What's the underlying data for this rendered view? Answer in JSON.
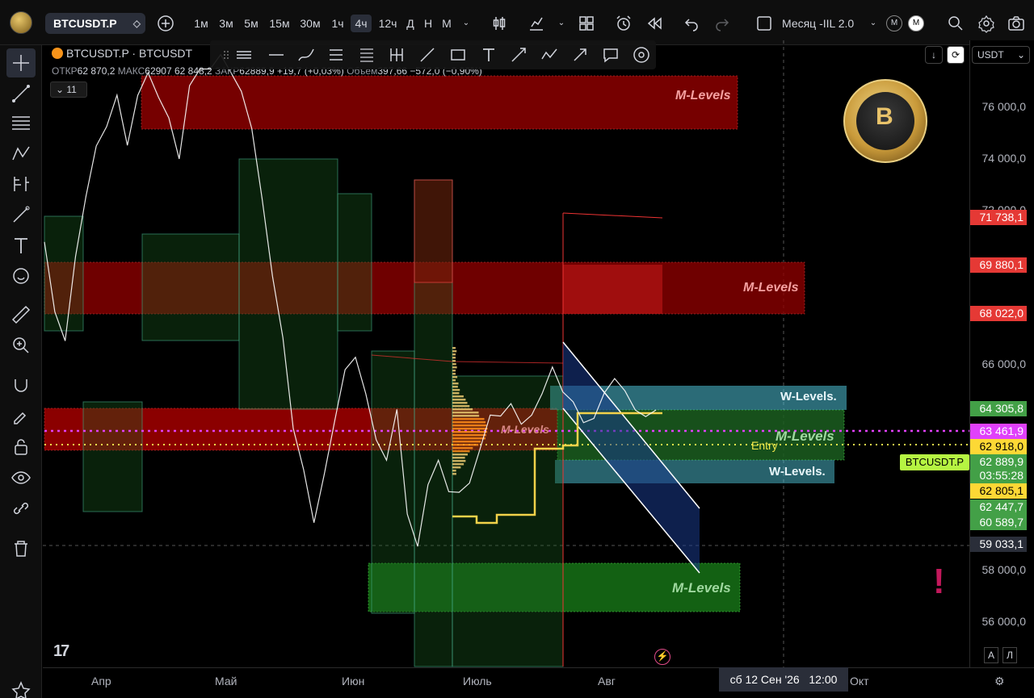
{
  "toolbar": {
    "symbol": "BTCUSDT.P",
    "timeframes": [
      "1м",
      "3м",
      "5м",
      "15м",
      "30м",
      "1ч",
      "4ч",
      "12ч",
      "Д",
      "Н",
      "М"
    ],
    "active_timeframe": "4ч",
    "indicator_name": "Месяц -IIL 2.0",
    "mode_m": "M",
    "mode_m2": "M"
  },
  "legend": {
    "title": "BTCUSDT.P · BTCUSDT",
    "open_label": "ОТКР",
    "open": "62 870,2",
    "high_label": "МАКС",
    "high": "62907",
    "low": "62 848,2",
    "close_label": "ЗАКР",
    "close": "62889,9",
    "change": "+19,7 (+0,03%)",
    "volume_label": "Объем",
    "volume": "397,66",
    "volume_change": "−572,0 (−0,90%)",
    "indicator_count": "11"
  },
  "price_axis": {
    "currency": "USDT",
    "ticks": [
      {
        "label": "76 000,0",
        "value": 76000
      },
      {
        "label": "74 000,0",
        "value": 74000
      },
      {
        "label": "72 000,0",
        "value": 72000
      },
      {
        "label": "66 000,0",
        "value": 66000
      },
      {
        "label": "58 000,0",
        "value": 58000
      },
      {
        "label": "56 000,0",
        "value": 56000
      }
    ],
    "tags": [
      {
        "label": "71 738,1",
        "value": 71738.1,
        "color": "#e53935"
      },
      {
        "label": "69 880,1",
        "value": 69880.1,
        "color": "#e53935"
      },
      {
        "label": "68 022,0",
        "value": 68022.0,
        "color": "#e53935"
      },
      {
        "label": "64 305,8",
        "value": 64305.8,
        "color": "#43a047"
      },
      {
        "label": "63 461,9",
        "value": 63461.9,
        "color": "#e040fb"
      },
      {
        "label": "62 918,0",
        "value": 62918.0,
        "color": "#fdd835"
      },
      {
        "label": "62 889,9",
        "value": 62889.9,
        "color": "#43a047"
      },
      {
        "label": "03:55:28",
        "value": 62600,
        "color": "#43a047"
      },
      {
        "label": "62 805,1",
        "value": 62805.1,
        "color": "#fdd835"
      },
      {
        "label": "62 447,7",
        "value": 62447.7,
        "color": "#43a047"
      },
      {
        "label": "60 589,7",
        "value": 60589.7,
        "color": "#43a047"
      },
      {
        "label": "59 033,1",
        "value": 59033.1,
        "color": "#2a2e39"
      }
    ],
    "symbol_tag": "BTCUSDT.P"
  },
  "time_axis": {
    "labels": [
      "Апр",
      "Май",
      "Июн",
      "Июль",
      "Авг",
      "Окт"
    ],
    "cursor_date": "сб 12 Сен '26",
    "cursor_time": "12:00",
    "toggle_a": "A",
    "toggle_l": "Л"
  },
  "annotations": {
    "m_levels": "M-Levels",
    "w_levels": "W-Levels.",
    "entry": "Entry",
    "m_levels_small": "M-Levels"
  },
  "colors": {
    "bg": "#000000",
    "red_zone": "#8b0000",
    "green_zone": "#1b5e20",
    "cyan_zone": "#4fc3d8",
    "entry_line": "#f2e84a",
    "magenta_line": "#e040fb"
  }
}
